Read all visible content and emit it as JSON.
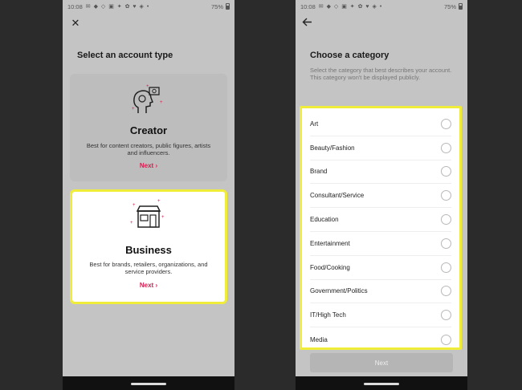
{
  "status_left": {
    "time": "10:08",
    "notif_icons": "✉ ◆ ◇ ▣ ✦ ✿ ♥ ◈ •",
    "battery": "75%"
  },
  "status_right": {
    "time": "10:08",
    "notif_icons": "✉ ◆ ◇ ▣ ✦ ✿ ♥ ◈ •",
    "battery": "75%"
  },
  "account": {
    "title": "Select an account type",
    "creator": {
      "title": "Creator",
      "description": "Best for content creators, public figures, artists and influencers.",
      "next_label": "Next ›"
    },
    "business": {
      "title": "Business",
      "description": "Best for brands, retailers, organizations, and service providers.",
      "next_label": "Next ›"
    }
  },
  "category": {
    "title": "Choose a category",
    "hint": "Select the category that best describes your account. This category won't be displayed publicly.",
    "items": [
      "Art",
      "Beauty/Fashion",
      "Brand",
      "Consultant/Service",
      "Education",
      "Entertainment",
      "Food/Cooking",
      "Government/Politics",
      "IT/High Tech",
      "Media"
    ],
    "next_label": "Next"
  },
  "colors": {
    "highlight": "#f0ec3a",
    "accent": "#d81e4f",
    "overlay": "#c4c4c4"
  },
  "icons": {
    "close": "close-icon",
    "back": "back-arrow-icon",
    "creator": "creator-head-icon",
    "business": "storefront-icon"
  }
}
